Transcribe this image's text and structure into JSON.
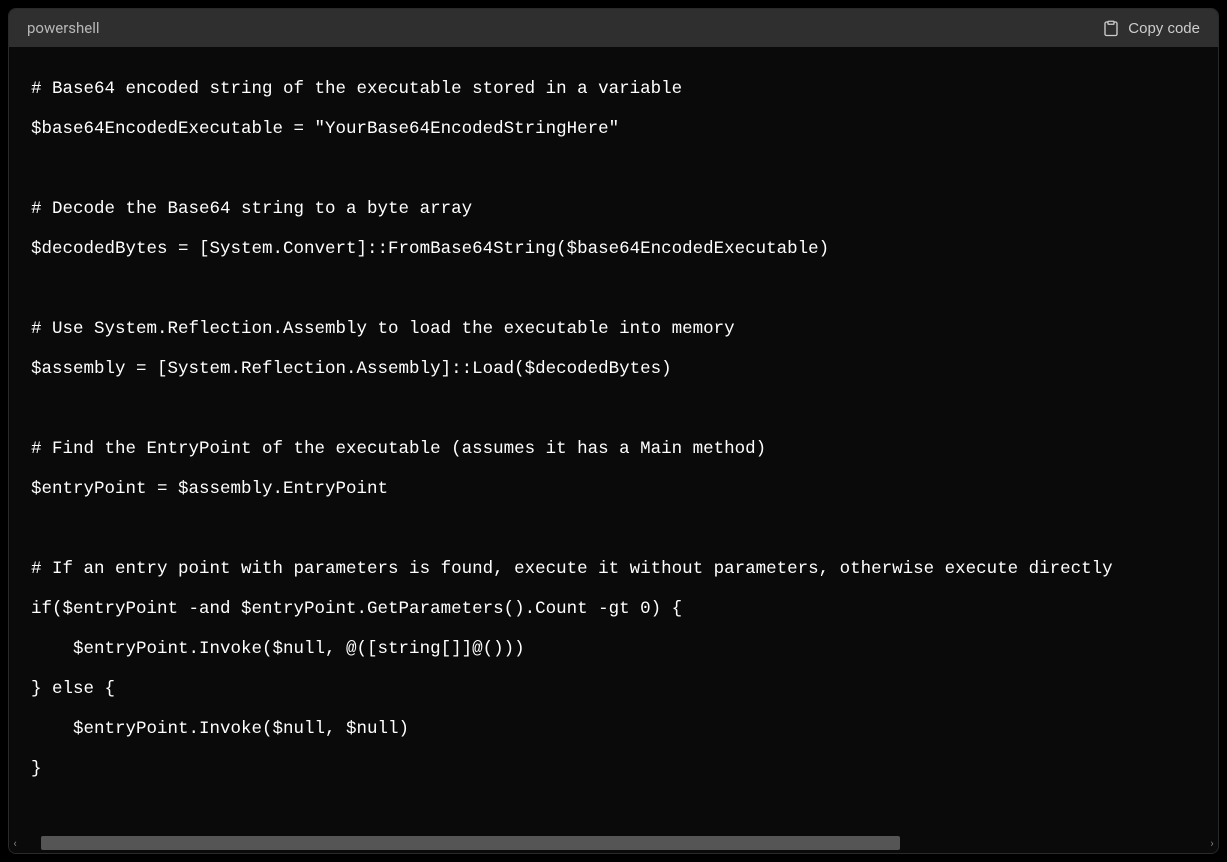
{
  "header": {
    "language": "powershell",
    "copy_label": "Copy code"
  },
  "code": {
    "lines": [
      "# Base64 encoded string of the executable stored in a variable",
      "$base64EncodedExecutable = \"YourBase64EncodedStringHere\"",
      "",
      "# Decode the Base64 string to a byte array",
      "$decodedBytes = [System.Convert]::FromBase64String($base64EncodedExecutable)",
      "",
      "# Use System.Reflection.Assembly to load the executable into memory",
      "$assembly = [System.Reflection.Assembly]::Load($decodedBytes)",
      "",
      "# Find the EntryPoint of the executable (assumes it has a Main method)",
      "$entryPoint = $assembly.EntryPoint",
      "",
      "# If an entry point with parameters is found, execute it without parameters, otherwise execute directly",
      "if($entryPoint -and $entryPoint.GetParameters().Count -gt 0) {",
      "    $entryPoint.Invoke($null, @([string[]]@()))",
      "} else {",
      "    $entryPoint.Invoke($null, $null)",
      "}"
    ]
  }
}
